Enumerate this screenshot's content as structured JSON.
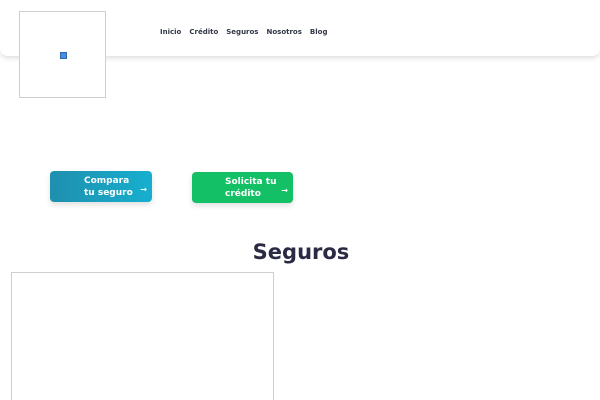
{
  "nav": {
    "items": [
      {
        "label": "Inicio"
      },
      {
        "label": "Crédito"
      },
      {
        "label": "Seguros"
      },
      {
        "label": "Nosotros"
      },
      {
        "label": "Blog"
      }
    ]
  },
  "cta": {
    "compare_label": "Compara tu seguro",
    "credit_label": "Solicita tu crédito",
    "arrow": "→"
  },
  "section": {
    "title": "Seguros"
  },
  "colors": {
    "compare_button": "#1f8fae",
    "credit_button": "#13c065",
    "title_text": "#2b2a45"
  },
  "icons": {
    "logo": "broken-image-icon",
    "cta_arrow": "arrow-right-icon"
  }
}
